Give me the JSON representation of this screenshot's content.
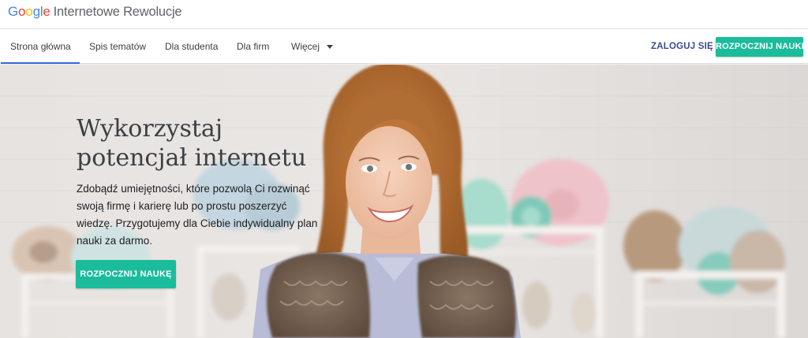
{
  "brand": {
    "google_letters": [
      "G",
      "o",
      "o",
      "g",
      "l",
      "e"
    ],
    "product": "Internetowe Rewolucje"
  },
  "nav": {
    "items": [
      {
        "label": "Strona główna",
        "active": true
      },
      {
        "label": "Spis tematów",
        "active": false
      },
      {
        "label": "Dla studenta",
        "active": false
      },
      {
        "label": "Dla firm",
        "active": false
      }
    ],
    "more_label": "Więcej",
    "login_label": "ZALOGUJ SIĘ",
    "start_label": "ROZPOCZNIJ NAUKĘ"
  },
  "hero": {
    "title": "Wykorzystaj potencjał internetu",
    "text": "Zdobądź umiejętności, które pozwolą Ci rozwinąć swoją firmę i karierę lub po prostu poszerzyć wiedzę. Przygotujemy dla Ciebie indywidualny plan nauki za darmo.",
    "cta_label": "ROZPOCZNIJ NAUKĘ"
  },
  "colors": {
    "accent_teal": "#1bbc9b",
    "nav_active_underline": "#3367d6",
    "login_text": "#3c4a8f",
    "google_blue": "#4285f4",
    "google_red": "#ea4335",
    "google_yellow": "#fbbc05",
    "google_green": "#34a853"
  }
}
